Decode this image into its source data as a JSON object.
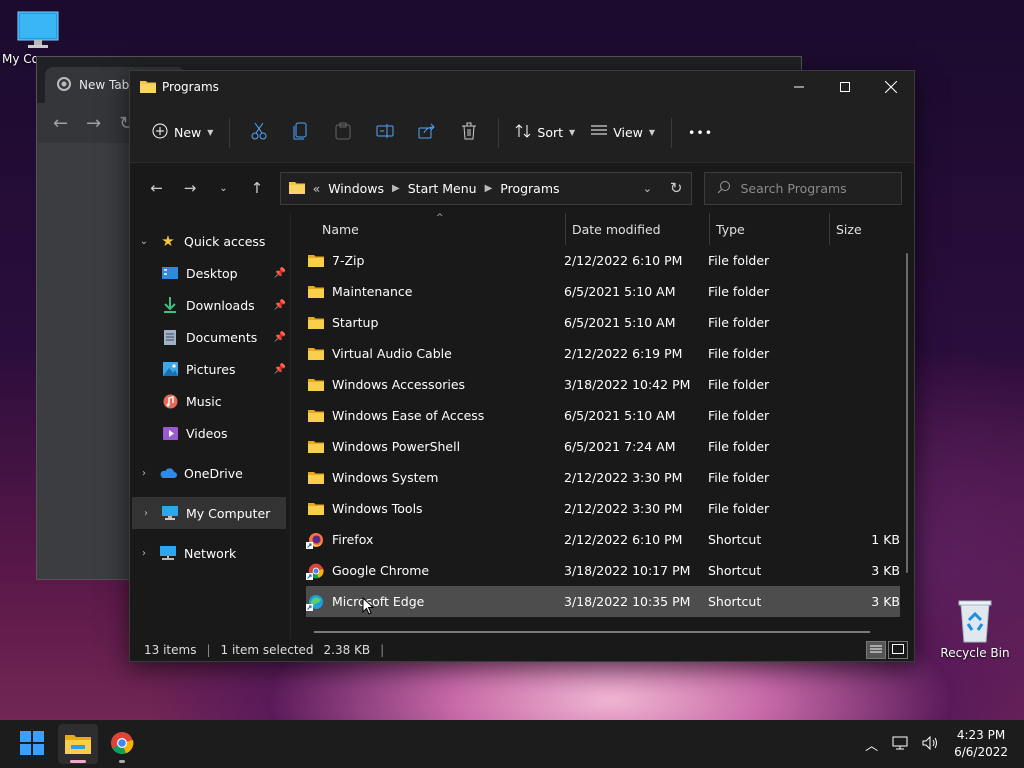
{
  "desktop": {
    "icons": [
      {
        "label": "My Co"
      },
      {
        "label": "Recycle Bin"
      }
    ]
  },
  "chrome": {
    "tab_label": "New Tab"
  },
  "explorer": {
    "title": "Programs",
    "toolbar": {
      "new_label": "New",
      "sort_label": "Sort",
      "view_label": "View",
      "more_label": "•••"
    },
    "address": {
      "overflow": "«",
      "crumbs": [
        "Windows",
        "Start Menu",
        "Programs"
      ]
    },
    "search_placeholder": "Search Programs",
    "nav": {
      "quick_access": "Quick access",
      "desktop": "Desktop",
      "downloads": "Downloads",
      "documents": "Documents",
      "pictures": "Pictures",
      "music": "Music",
      "videos": "Videos",
      "onedrive": "OneDrive",
      "my_computer": "My Computer",
      "network": "Network"
    },
    "columns": {
      "name": "Name",
      "date": "Date modified",
      "type": "Type",
      "size": "Size"
    },
    "files": [
      {
        "name": "7-Zip",
        "date": "2/12/2022 6:10 PM",
        "type": "File folder",
        "size": "",
        "icon": "folder"
      },
      {
        "name": "Maintenance",
        "date": "6/5/2021 5:10 AM",
        "type": "File folder",
        "size": "",
        "icon": "folder"
      },
      {
        "name": "Startup",
        "date": "6/5/2021 5:10 AM",
        "type": "File folder",
        "size": "",
        "icon": "folder"
      },
      {
        "name": "Virtual Audio Cable",
        "date": "2/12/2022 6:19 PM",
        "type": "File folder",
        "size": "",
        "icon": "folder"
      },
      {
        "name": "Windows Accessories",
        "date": "3/18/2022 10:42 PM",
        "type": "File folder",
        "size": "",
        "icon": "folder"
      },
      {
        "name": "Windows Ease of Access",
        "date": "6/5/2021 5:10 AM",
        "type": "File folder",
        "size": "",
        "icon": "folder"
      },
      {
        "name": "Windows PowerShell",
        "date": "6/5/2021 7:24 AM",
        "type": "File folder",
        "size": "",
        "icon": "folder"
      },
      {
        "name": "Windows System",
        "date": "2/12/2022 3:30 PM",
        "type": "File folder",
        "size": "",
        "icon": "folder"
      },
      {
        "name": "Windows Tools",
        "date": "2/12/2022 3:30 PM",
        "type": "File folder",
        "size": "",
        "icon": "folder"
      },
      {
        "name": "Firefox",
        "date": "2/12/2022 6:10 PM",
        "type": "Shortcut",
        "size": "1 KB",
        "icon": "firefox"
      },
      {
        "name": "Google Chrome",
        "date": "3/18/2022 10:17 PM",
        "type": "Shortcut",
        "size": "3 KB",
        "icon": "chrome"
      },
      {
        "name": "Microsoft Edge",
        "date": "3/18/2022 10:35 PM",
        "type": "Shortcut",
        "size": "3 KB",
        "icon": "edge"
      }
    ],
    "status": {
      "count": "13 items",
      "selected": "1 item selected",
      "size": "2.38 KB"
    }
  },
  "taskbar": {
    "time": "4:23 PM",
    "date": "6/6/2022"
  }
}
